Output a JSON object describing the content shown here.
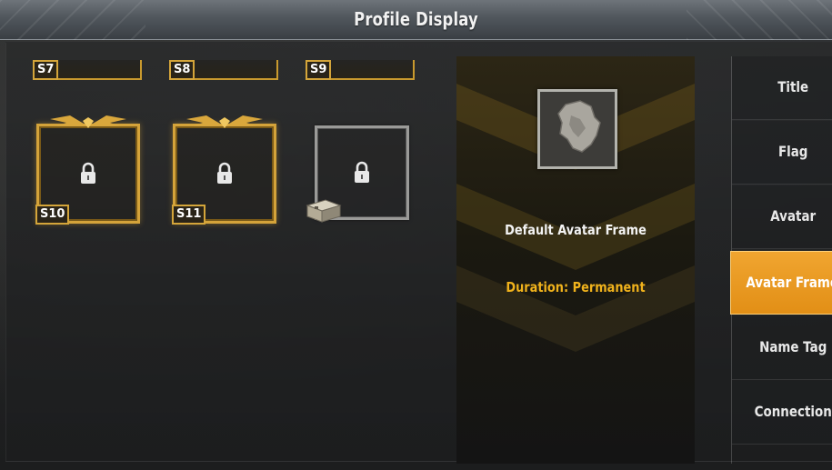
{
  "header": {
    "title": "Profile Display"
  },
  "frames": {
    "top_row": [
      {
        "season": "S7"
      },
      {
        "season": "S8"
      },
      {
        "season": "S9"
      }
    ],
    "second_row": [
      {
        "season": "S10",
        "locked": true,
        "style": "gold"
      },
      {
        "season": "S11",
        "locked": true,
        "style": "gold"
      },
      {
        "season": "",
        "locked": true,
        "style": "plain"
      }
    ],
    "icons": {
      "lock": "lock-icon",
      "crate": "crate-icon"
    }
  },
  "preview": {
    "name": "Default Avatar Frame",
    "duration": "Duration: Permanent"
  },
  "menu": {
    "items": [
      {
        "label": "Title",
        "active": false
      },
      {
        "label": "Flag",
        "active": false
      },
      {
        "label": "Avatar",
        "active": false
      },
      {
        "label": "Avatar Frame",
        "active": true
      },
      {
        "label": "Name Tag",
        "active": false
      },
      {
        "label": "Connection",
        "active": false
      }
    ]
  },
  "colors": {
    "gold": "#d4a33a",
    "accent": "#e8991f",
    "duration": "#f0b21c"
  }
}
